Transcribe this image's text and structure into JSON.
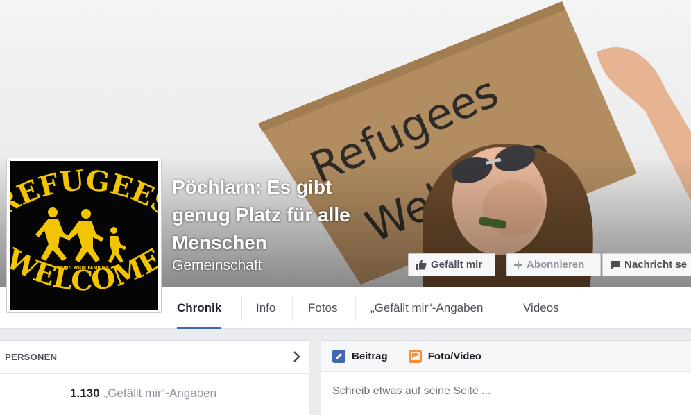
{
  "page": {
    "title": "Pöchlarn: Es gibt genug Platz für alle Menschen",
    "category": "Gemeinschaft"
  },
  "cover": {
    "sign_text_line1": "Refugees",
    "sign_text_line2": "Welcome"
  },
  "profile_picture": {
    "top_text": "REFUGEES",
    "slogan": "BRING YOUR FAMILIES!",
    "bottom_text": "WELCOME"
  },
  "actions": {
    "like_label": "Gefällt mir",
    "follow_label": "Abonnieren",
    "message_label": "Nachricht se",
    "like_icon": "thumbs-up-icon",
    "follow_icon": "plus-icon",
    "message_icon": "speech-bubble-icon"
  },
  "tabs": [
    {
      "label": "Chronik",
      "active": true
    },
    {
      "label": "Info"
    },
    {
      "label": "Fotos"
    },
    {
      "label": "„Gefällt mir“-Angaben"
    },
    {
      "label": "Videos"
    }
  ],
  "people_card": {
    "header": "PERSONEN",
    "likes_count": "1.130",
    "likes_label": "„Gefällt mir“-Angaben"
  },
  "composer": {
    "tab_post": "Beitrag",
    "tab_photo": "Foto/Video",
    "placeholder": "Schreib etwas auf seine Seite ..."
  },
  "colors": {
    "accent": "#4267b2",
    "badge_yellow": "#f2c500",
    "cardboard": "#b08a5e"
  }
}
